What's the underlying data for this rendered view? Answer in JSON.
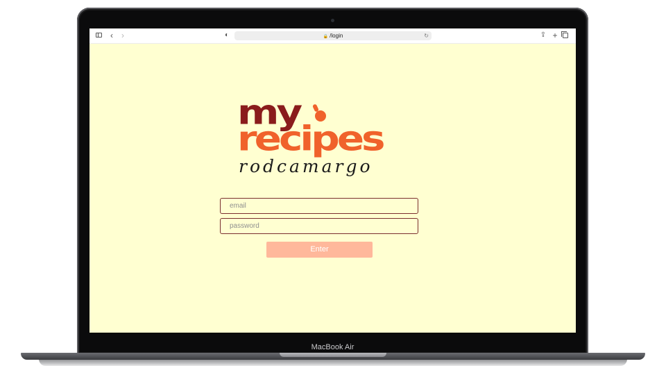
{
  "browser": {
    "url": "/login",
    "icons": [
      "sidebar-icon",
      "back-icon",
      "forward-icon",
      "privacy-shield-icon",
      "lock-icon",
      "reload-icon",
      "share-icon",
      "new-tab-icon",
      "tab-overview-icon"
    ]
  },
  "logo": {
    "line1": "my",
    "line2": "recipes",
    "signature": "rodcamargo",
    "colors": {
      "my": "#8a1c1c",
      "recipes": "#f0622b"
    }
  },
  "login": {
    "email_placeholder": "email",
    "password_placeholder": "password",
    "submit_label": "Enter",
    "button_color": "#ffb89b",
    "background_color": "#ffffd1"
  },
  "device": {
    "label": "MacBook Air"
  }
}
